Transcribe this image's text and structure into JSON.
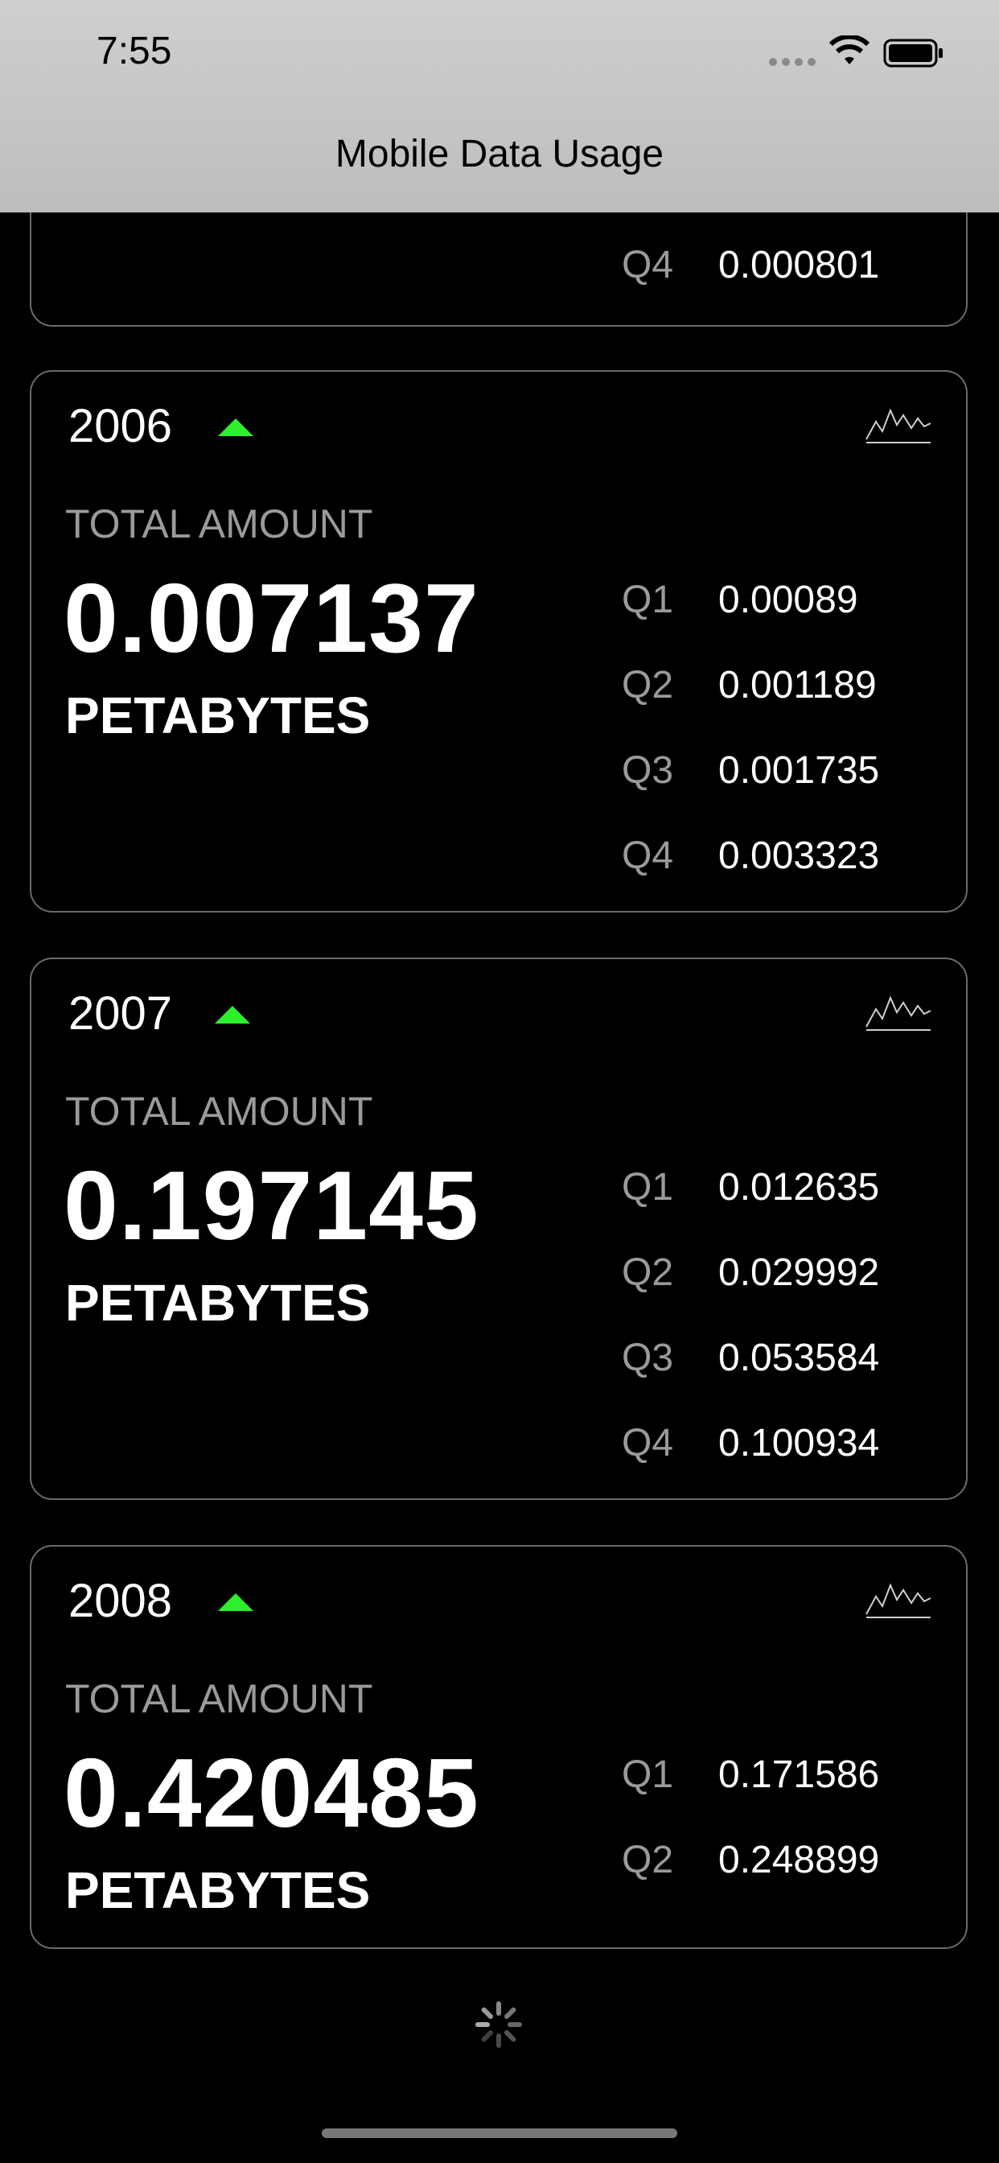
{
  "status_bar": {
    "time": "7:55"
  },
  "nav": {
    "title": "Mobile Data Usage"
  },
  "cards": {
    "partial": {
      "q4_label": "Q4",
      "q4_value": "0.000801"
    },
    "y2006": {
      "year": "2006",
      "trend": "up",
      "total_label": "TOTAL AMOUNT",
      "total": "0.007137",
      "unit": "PETABYTES",
      "quarters": [
        {
          "label": "Q1",
          "value": "0.00089"
        },
        {
          "label": "Q2",
          "value": "0.001189"
        },
        {
          "label": "Q3",
          "value": "0.001735"
        },
        {
          "label": "Q4",
          "value": "0.003323"
        }
      ]
    },
    "y2007": {
      "year": "2007",
      "trend": "up",
      "total_label": "TOTAL AMOUNT",
      "total": "0.197145",
      "unit": "PETABYTES",
      "quarters": [
        {
          "label": "Q1",
          "value": "0.012635"
        },
        {
          "label": "Q2",
          "value": "0.029992"
        },
        {
          "label": "Q3",
          "value": "0.053584"
        },
        {
          "label": "Q4",
          "value": "0.100934"
        }
      ]
    },
    "y2008": {
      "year": "2008",
      "trend": "up",
      "total_label": "TOTAL AMOUNT",
      "total": "0.420485",
      "unit": "PETABYTES",
      "quarters": [
        {
          "label": "Q1",
          "value": "0.171586"
        },
        {
          "label": "Q2",
          "value": "0.248899"
        }
      ]
    }
  },
  "colors": {
    "trend_up": "#2df02d",
    "card_border": "#6b6b6b"
  },
  "icons": {
    "chart": "chart-icon",
    "loading": "spinner-icon"
  }
}
